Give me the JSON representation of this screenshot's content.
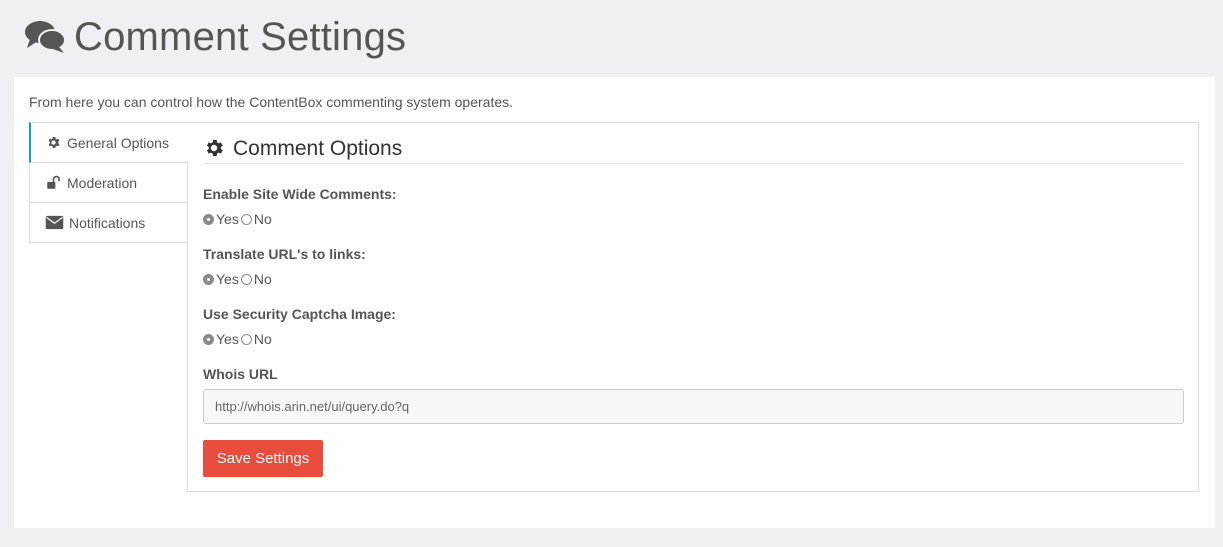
{
  "header": {
    "title": "Comment Settings",
    "icon": "comments-icon"
  },
  "intro": "From here you can control how the ContentBox commenting system operates.",
  "tabs": [
    {
      "label": "General Options",
      "icon": "gear-icon",
      "active": true
    },
    {
      "label": "Moderation",
      "icon": "unlock-icon",
      "active": false
    },
    {
      "label": "Notifications",
      "icon": "envelope-icon",
      "active": false
    }
  ],
  "section": {
    "title": "Comment Options",
    "icon": "gear-icon"
  },
  "fields": {
    "site_wide": {
      "label": "Enable Site Wide Comments:",
      "yes": "Yes",
      "no": "No",
      "value": "Yes"
    },
    "translate_urls": {
      "label": "Translate URL's to links:",
      "yes": "Yes",
      "no": "No",
      "value": "Yes"
    },
    "captcha": {
      "label": "Use Security Captcha Image:",
      "yes": "Yes",
      "no": "No",
      "value": "Yes"
    },
    "whois": {
      "label": "Whois URL",
      "value": "http://whois.arin.net/ui/query.do?q"
    }
  },
  "save_button": "Save Settings",
  "colors": {
    "accent": "#1aa39a",
    "danger": "#e74c3c",
    "background": "#eff0f4"
  }
}
